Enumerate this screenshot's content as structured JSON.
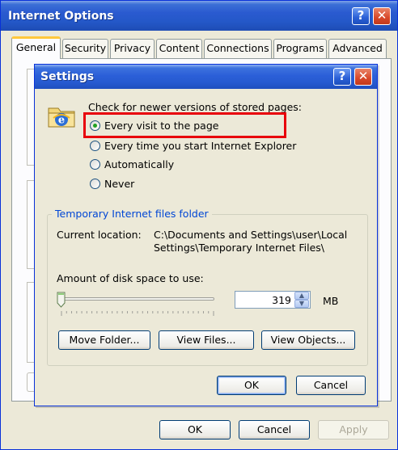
{
  "outer": {
    "title": "Internet Options",
    "tabs": [
      "General",
      "Security",
      "Privacy",
      "Content",
      "Connections",
      "Programs",
      "Advanced"
    ],
    "active_tab": "General",
    "buttons": {
      "ok": "OK",
      "cancel": "Cancel",
      "apply": "Apply"
    }
  },
  "dialog": {
    "title": "Settings",
    "check_label": "Check for newer versions of stored pages:",
    "options": [
      {
        "label": "Every visit to the page",
        "selected": true
      },
      {
        "label": "Every time you start Internet Explorer",
        "selected": false
      },
      {
        "label": "Automatically",
        "selected": false
      },
      {
        "label": "Never",
        "selected": false
      }
    ],
    "group_title": "Temporary Internet files folder",
    "current_location_label": "Current location:",
    "current_location_line1": "C:\\Documents and Settings\\user\\Local",
    "current_location_line2": "Settings\\Temporary Internet Files\\",
    "disk_space_label": "Amount of disk space to use:",
    "disk_space_value": "319",
    "unit": "MB",
    "slider_level": 0.0,
    "buttons": {
      "move_folder": "Move Folder...",
      "view_files": "View Files...",
      "view_objects": "View Objects...",
      "ok": "OK",
      "cancel": "Cancel"
    }
  },
  "colors": {
    "titlebar": "#2458c8",
    "highlight_box": "#e8000b",
    "group_title": "#0046d5",
    "radio_dot": "#21a121"
  }
}
